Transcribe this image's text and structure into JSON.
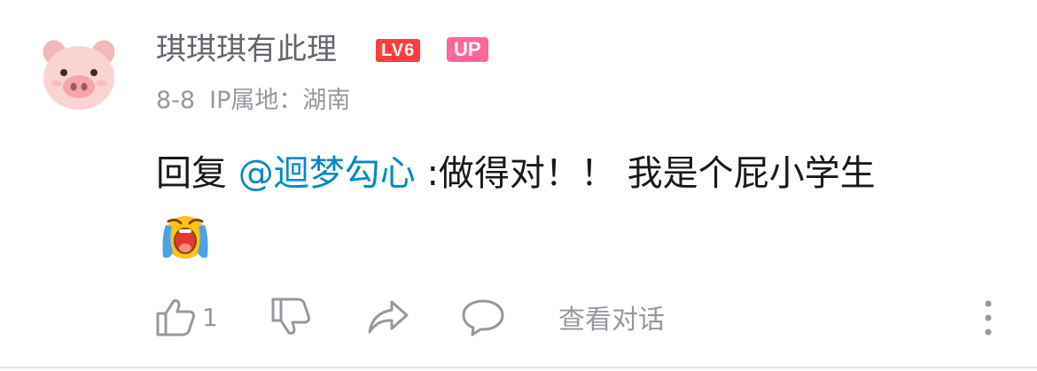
{
  "comment": {
    "username": "琪琪琪有此理",
    "level_badge": "LV6",
    "up_badge": "UP",
    "date": "8-8",
    "ip_location": "IP属地：湖南",
    "reply_prefix": "回复",
    "mention": "@迴梦勾心",
    "text": ":做得对！！ 我是个屁小学生",
    "emoji": "crying-emoji",
    "like_count": "1",
    "view_conversation": "查看对话"
  },
  "icons": {
    "like": "thumbs-up-icon",
    "dislike": "thumbs-down-icon",
    "share": "share-icon",
    "reply": "comment-bubble-icon",
    "more": "more-vertical-icon"
  },
  "colors": {
    "username": "#61666d",
    "meta": "#9499a0",
    "text": "#18191c",
    "mention": "#008ac5",
    "level_badge": "#ff3d3d",
    "up_badge": "#ff6699"
  }
}
